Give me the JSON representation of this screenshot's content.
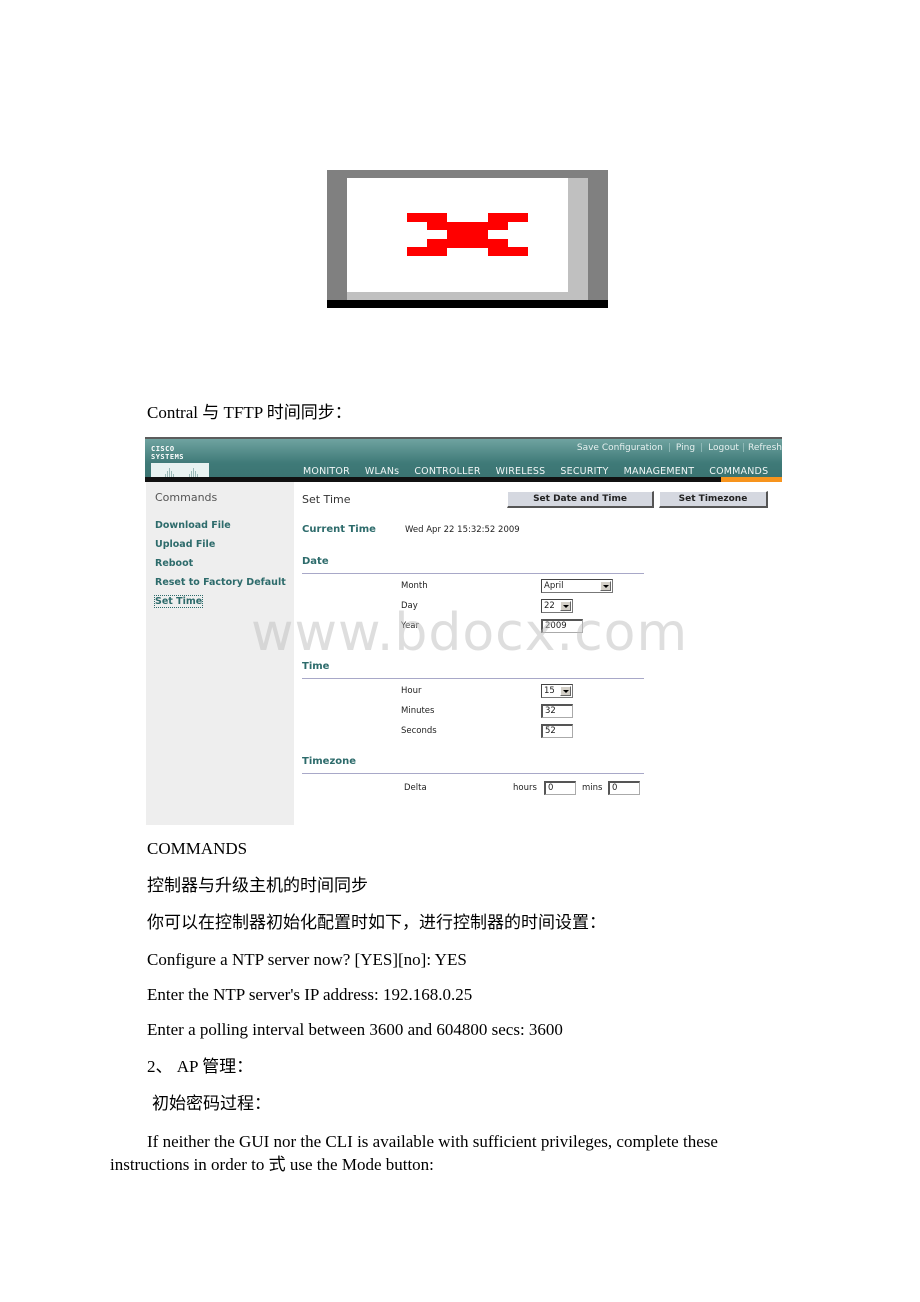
{
  "document": {
    "broken_image": {
      "icon": "broken-image-icon"
    },
    "heading_sync": "Contral 与 TFTP 时间同步：",
    "caption_commands": "COMMANDS",
    "para_sync_host": "控制器与升级主机的时间同步",
    "para_init_config": "你可以在控制器初始化配置时如下，进行控制器的时间设置：",
    "cli_line_1": "Configure a NTP server now? [YES][no]: YES",
    "cli_line_2": "Enter the NTP server's IP address: 192.168.0.25",
    "cli_line_3": "Enter a polling interval between 3600 and 604800 secs: 3600",
    "section_ap": "2、 AP 管理：",
    "sub_initial_password": "初始密码过程：",
    "para_mode_button_line1": "If neither the GUI nor the CLI is available with sufficient privileges, complete these",
    "para_mode_button_line2": "instructions in order to 式 use the Mode button:",
    "watermark": "www.bdocx.com"
  },
  "cisco_ui": {
    "logo_text": "CISCO SYSTEMS",
    "top_links": [
      "Save Configuration",
      "Ping",
      "Logout",
      "Refresh"
    ],
    "nav": [
      "MONITOR",
      "WLANs",
      "CONTROLLER",
      "WIRELESS",
      "SECURITY",
      "MANAGEMENT",
      "COMMANDS"
    ],
    "nav_active": "COMMANDS",
    "accent_color": "#f7941d",
    "sidebar": {
      "title": "Commands",
      "items": [
        "Download File",
        "Upload File",
        "Reboot",
        "Reset to Factory Default",
        "Set Time"
      ],
      "active": "Set Time"
    },
    "page_title": "Set Time",
    "buttons": {
      "set_date_time": "Set Date and Time",
      "set_timezone": "Set Timezone"
    },
    "current_time_label": "Current Time",
    "current_time_value": "Wed Apr 22 15:32:52 2009",
    "date": {
      "heading": "Date",
      "month_label": "Month",
      "month_value": "April",
      "day_label": "Day",
      "day_value": "22",
      "year_label": "Year",
      "year_value": "2009"
    },
    "time": {
      "heading": "Time",
      "hour_label": "Hour",
      "hour_value": "15",
      "minutes_label": "Minutes",
      "minutes_value": "32",
      "seconds_label": "Seconds",
      "seconds_value": "52"
    },
    "timezone": {
      "heading": "Timezone",
      "delta_label": "Delta",
      "hours_label": "hours",
      "hours_value": "0",
      "mins_label": "mins",
      "mins_value": "0"
    }
  }
}
